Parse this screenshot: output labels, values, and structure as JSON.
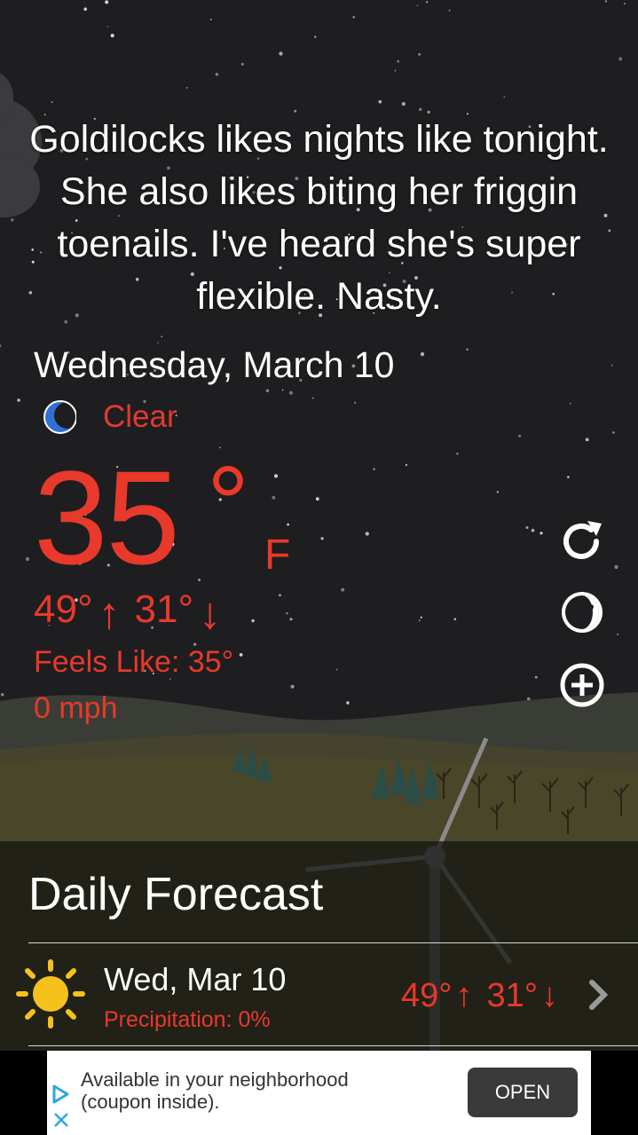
{
  "quote": "Goldilocks likes nights like tonight. She also likes biting her friggin toenails. I've heard she's super flexible. Nasty.",
  "current": {
    "date": "Wednesday, March 10",
    "condition_icon": "moon-icon",
    "condition": "Clear",
    "temperature": "35",
    "degree_symbol": "°",
    "unit": "F",
    "high": "49°",
    "high_arrow": "↑",
    "low": "31°",
    "low_arrow": "↓",
    "feels_like": "Feels Like: 35°",
    "wind": "0 mph"
  },
  "side_actions": [
    {
      "icon": "refresh-icon"
    },
    {
      "icon": "moon-phase-icon"
    },
    {
      "icon": "add-icon"
    }
  ],
  "forecast": {
    "title": "Daily Forecast",
    "rows": [
      {
        "icon": "sun-icon",
        "day": "Wed, Mar 10",
        "precipitation": "Precipitation: 0%",
        "high": "49°",
        "high_arrow": "↑",
        "low": "31°",
        "low_arrow": "↓"
      }
    ]
  },
  "ad": {
    "text": "Available in your neighborhood (coupon inside).",
    "button": "OPEN"
  },
  "colors": {
    "accent_red": "#e8392b",
    "text_white": "#ffffff",
    "moon_blue": "#2f6fd6",
    "sun_yellow": "#f5c21b"
  }
}
